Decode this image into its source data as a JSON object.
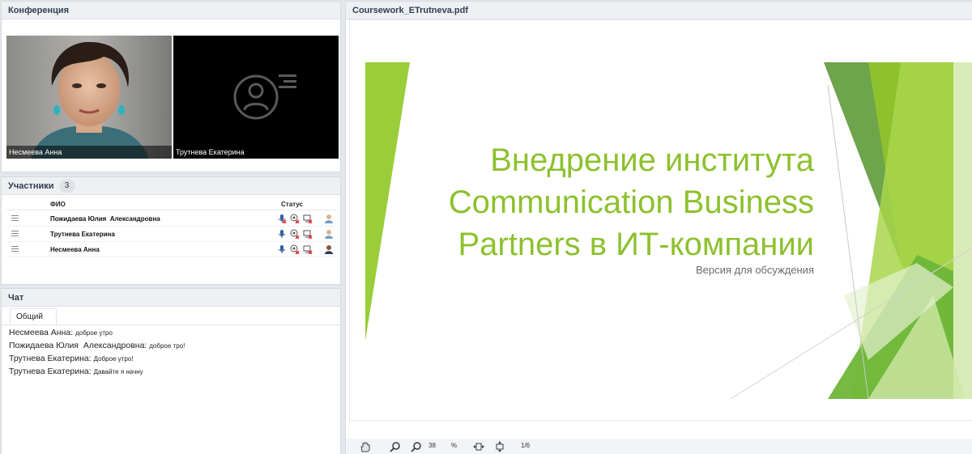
{
  "conference": {
    "title": "Конференция",
    "videos": [
      {
        "name": "Несмеева Анна",
        "has_camera": true
      },
      {
        "name": "Трутнева Екатерина",
        "has_camera": false
      }
    ]
  },
  "participants": {
    "title": "Участники",
    "count": "3",
    "col_name": "ФИО",
    "col_status": "Статус",
    "rows": [
      {
        "name": "Пожидаева Юлия  Александровна",
        "mic": "muted",
        "role": "guest"
      },
      {
        "name": "Трутнева Екатерина",
        "mic": "on",
        "role": "guest"
      },
      {
        "name": "Несмеева Анна",
        "mic": "on",
        "role": "host"
      }
    ]
  },
  "chat": {
    "title": "Чат",
    "tab": "Общий",
    "messages": [
      {
        "author": "Несмеева Анна:",
        "text": "доброе утро"
      },
      {
        "author": "Пожидаева Юлия  Александровна:",
        "text": "доброе тро!"
      },
      {
        "author": "Трутнева Екатерина:",
        "text": "Доброе утро!"
      },
      {
        "author": "Трутнева Екатерина:",
        "text": "Давайте я начну"
      }
    ]
  },
  "document": {
    "filename": "Coursework_ETrutneva.pdf",
    "slide_title": "Внедрение института\nCommunication Business\nPartners в ИТ-компании",
    "slide_subtitle": "Версия для обсуждения",
    "zoom": "38",
    "zoom_unit": "%",
    "page_indicator": "1/6"
  },
  "colors": {
    "accent_green": "#8dc12e",
    "panel_header_bg": "#eef0f3",
    "icon_red": "#d9232d",
    "icon_blue": "#2f5f9e"
  },
  "icons": {
    "drag": "drag-handle-icon",
    "mic": "microphone-icon",
    "camera_off": "camera-off-icon",
    "screen_off": "screen-share-off-icon",
    "user": "user-avatar-icon",
    "hand": "hand-pan-icon",
    "zoom_in": "zoom-in-icon",
    "zoom_out": "zoom-out-icon",
    "fit_width": "fit-width-icon",
    "fit_page": "fit-page-icon"
  }
}
